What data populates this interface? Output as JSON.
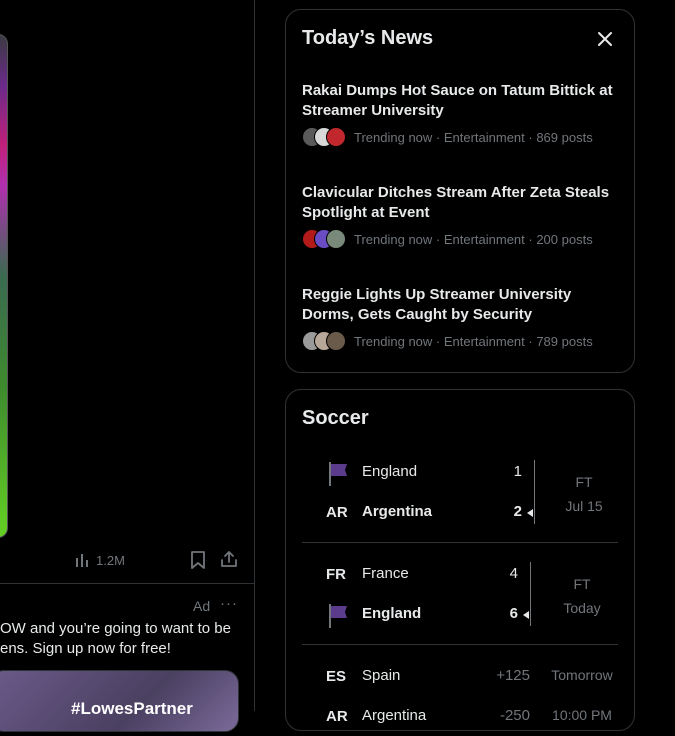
{
  "timeline": {
    "views_count": "1.2M",
    "ad": {
      "label": "Ad",
      "more": "···",
      "line1": "OW and you’re going to want to be",
      "line2": "ens. Sign up now for free!",
      "card_text": "#LowesPartner"
    }
  },
  "news": {
    "title": "Today’s News",
    "items": [
      {
        "headline": "Rakai Dumps Hot Sauce on Tatum Bittick at Streamer University",
        "meta": "Trending now · Entertainment · 869 posts",
        "avatar_colors": [
          "#5a5a5a",
          "#d8d8d8",
          "#c0282d"
        ]
      },
      {
        "headline": "Clavicular Ditches Stream After Zeta Steals Spotlight at Event",
        "meta": "Trending now · Entertainment · 200 posts",
        "avatar_colors": [
          "#b31b1b",
          "#6a4cc4",
          "#7a8a7a"
        ]
      },
      {
        "headline": "Reggie Lights Up Streamer University Dorms, Gets Caught by Security",
        "meta": "Trending now · Entertainment · 789 posts",
        "avatar_colors": [
          "#9a9a9a",
          "#b8a89a",
          "#6a5a4a"
        ]
      }
    ]
  },
  "soccer": {
    "title": "Soccer",
    "matches": [
      {
        "teams": [
          {
            "code": "",
            "flag": true,
            "name": "England",
            "score": "1",
            "winner": false
          },
          {
            "code": "AR",
            "flag": false,
            "name": "Argentina",
            "score": "2",
            "winner": true
          }
        ],
        "status": "FT",
        "date": "Jul 15"
      },
      {
        "teams": [
          {
            "code": "FR",
            "flag": false,
            "name": "France",
            "score": "4",
            "winner": false
          },
          {
            "code": "",
            "flag": true,
            "name": "England",
            "score": "6",
            "winner": true
          }
        ],
        "status": "FT",
        "date": "Today"
      },
      {
        "teams": [
          {
            "code": "ES",
            "flag": false,
            "name": "Spain",
            "score": "+125",
            "winner": false
          },
          {
            "code": "AR",
            "flag": false,
            "name": "Argentina",
            "score": "-250",
            "winner": false
          }
        ],
        "status": "Tomorrow",
        "date": "10:00 PM"
      }
    ]
  },
  "colors": {
    "background": "#000000",
    "text": "#e7e9ea",
    "muted": "#71767b",
    "border": "#2f3336",
    "flag_purple": "#5b3c8c"
  }
}
